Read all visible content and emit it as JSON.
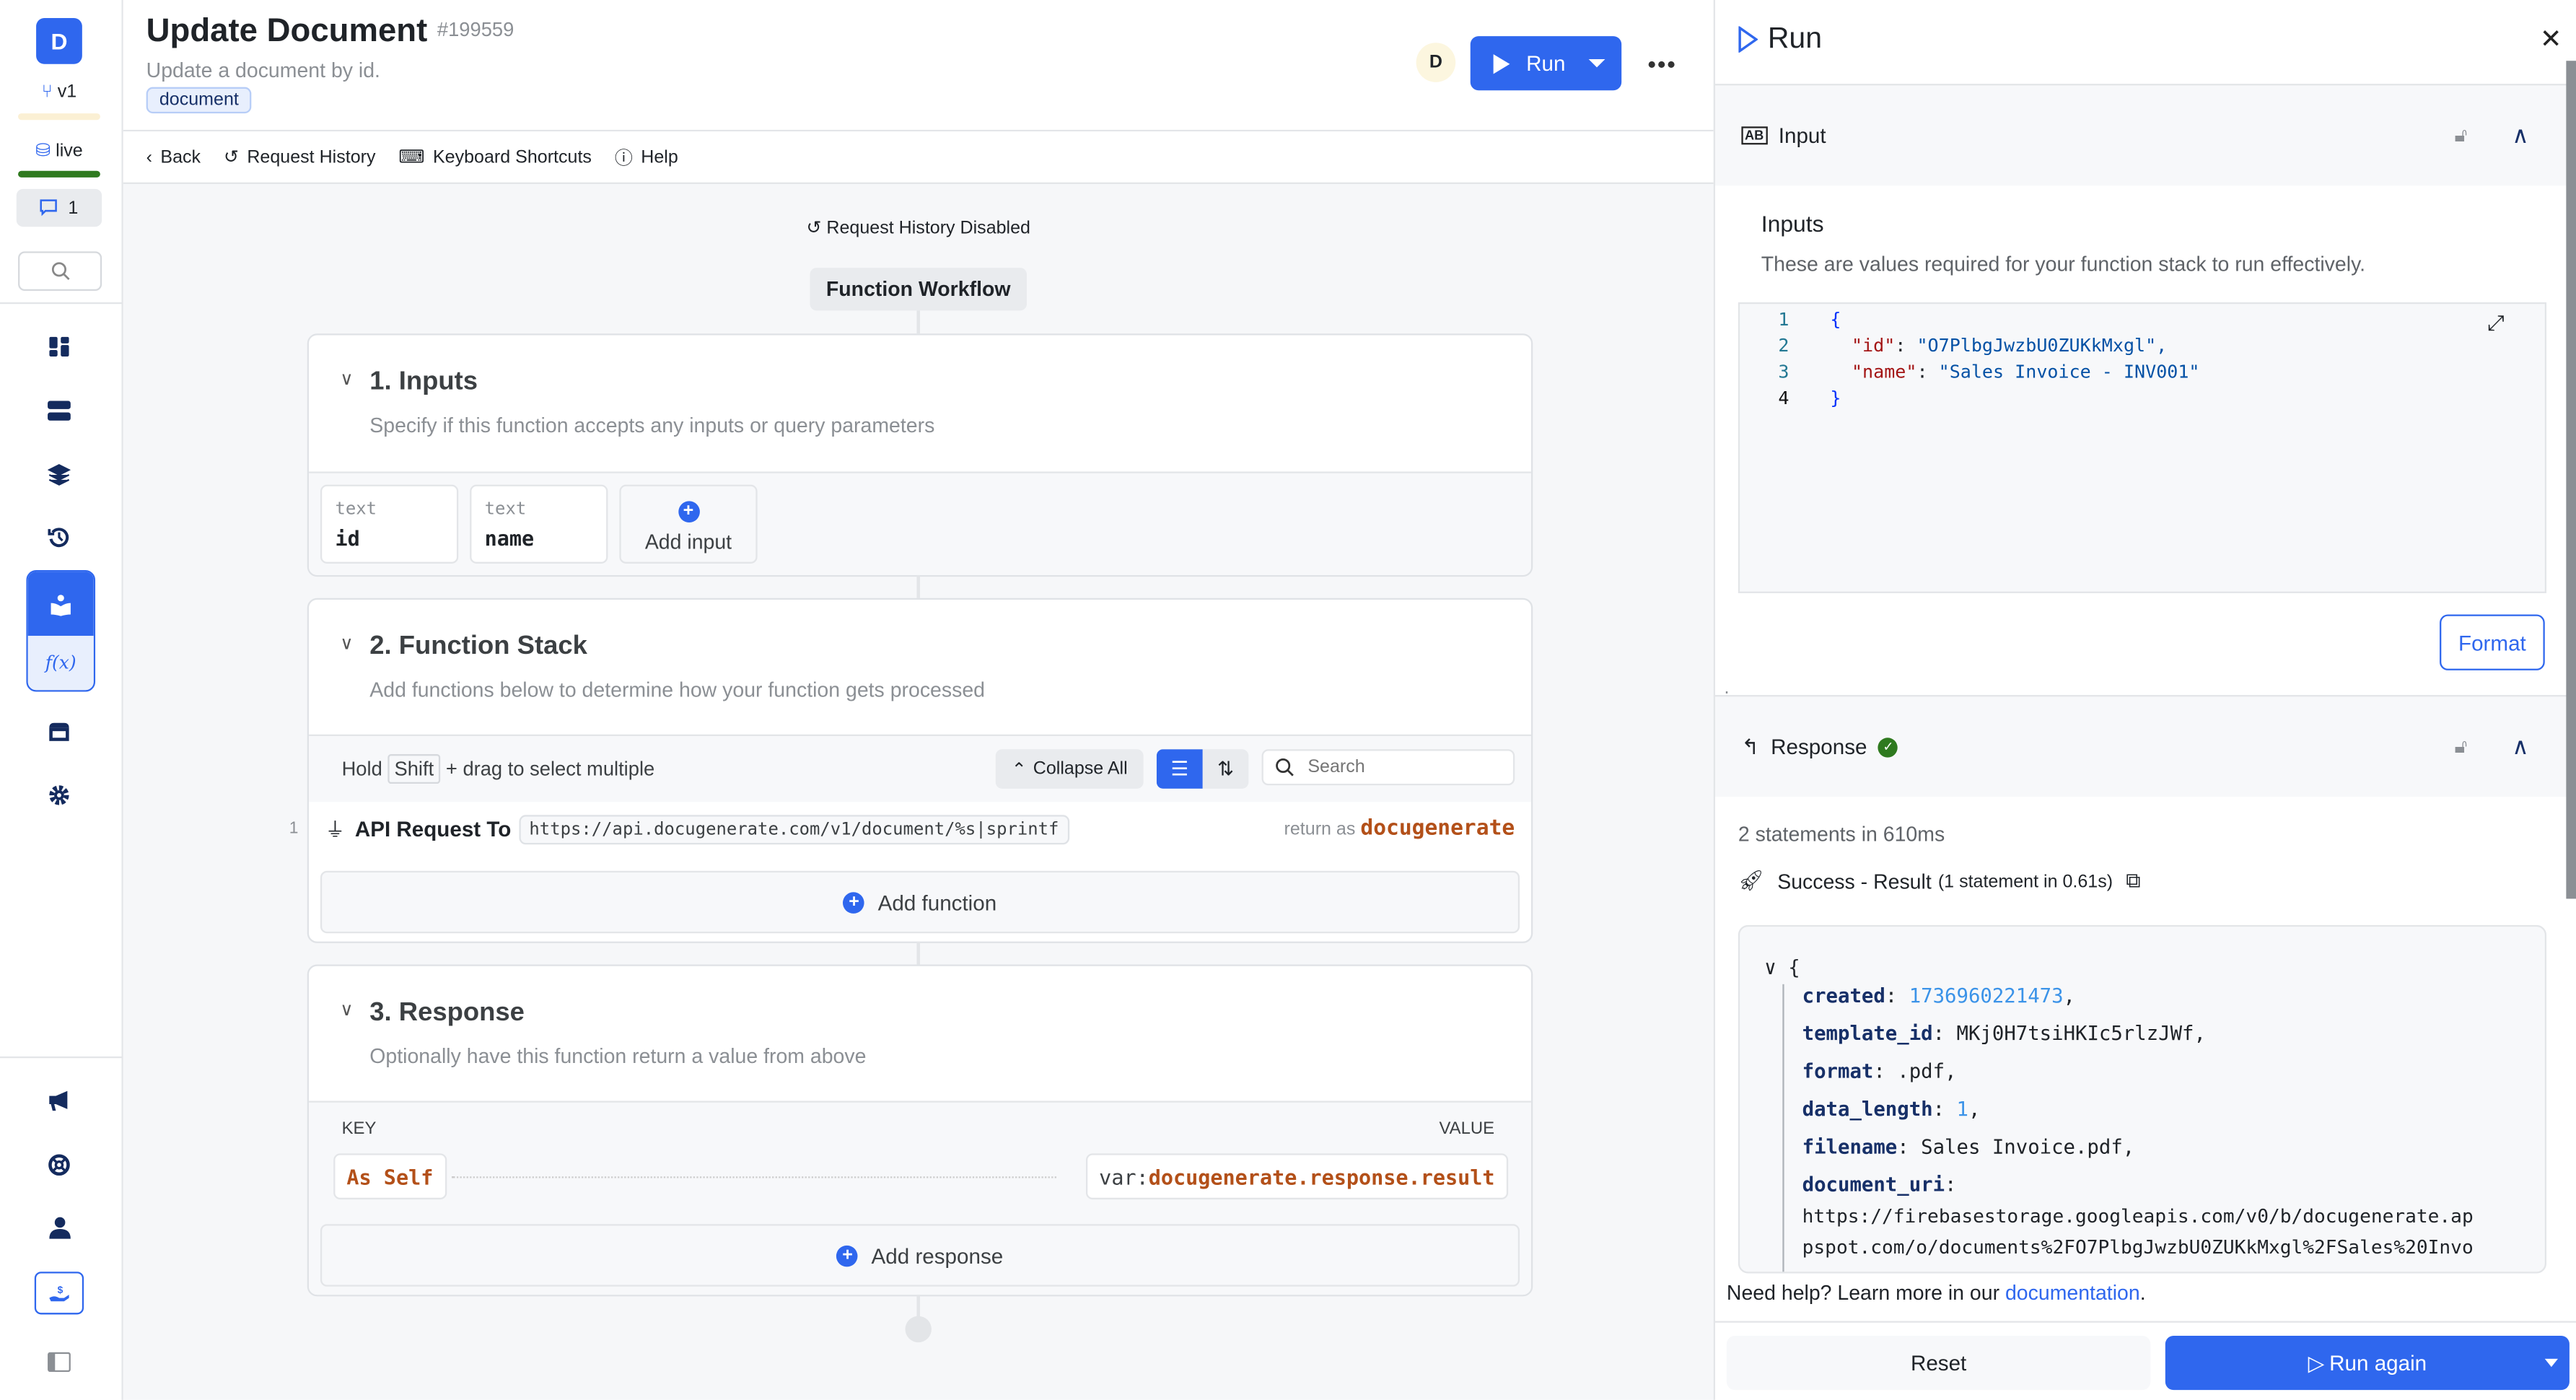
{
  "rail": {
    "logo_letter": "D",
    "branch": "v1",
    "environment": "live",
    "comment_count": "1",
    "icons": [
      "dashboard-icon",
      "database-icon",
      "layers-icon",
      "history-icon",
      "library-icon",
      "function-icon",
      "marketplace-icon",
      "settings-icon",
      "megaphone-icon",
      "support-icon",
      "user-icon",
      "billing-icon",
      "sidebar-toggle-icon"
    ]
  },
  "header": {
    "title": "Update Document",
    "id": "#199559",
    "description": "Update a document by id.",
    "tag": "document",
    "avatar_letter": "D",
    "run_label": "Run",
    "more_label": "•••"
  },
  "toolbar": {
    "back": "Back",
    "request_history": "Request History",
    "keyboard_shortcuts": "Keyboard Shortcuts",
    "help": "Help"
  },
  "canvas": {
    "request_history_status": "Request History Disabled",
    "workflow_label": "Function Workflow",
    "inputs": {
      "title": "1. Inputs",
      "description": "Specify if this function accepts any inputs or query parameters",
      "items": [
        {
          "type": "text",
          "name": "id"
        },
        {
          "type": "text",
          "name": "name"
        }
      ],
      "add_label": "Add input"
    },
    "function_stack": {
      "title": "2. Function Stack",
      "description": "Add functions below to determine how your function gets processed",
      "hint_pre": "Hold",
      "hint_key": "Shift",
      "hint_post": "+ drag to select multiple",
      "collapse_all": "Collapse All",
      "search_placeholder": "Search",
      "functions": [
        {
          "index": "1",
          "name": "API Request To",
          "url": "https://api.docugenerate.com/v1/document/%s|sprintf",
          "return_prefix": "return as",
          "return_var": "docugenerate"
        }
      ],
      "add_label": "Add function"
    },
    "response": {
      "title": "3. Response",
      "description": "Optionally have this function return a value from above",
      "key_header": "KEY",
      "value_header": "VALUE",
      "key": "As Self",
      "value_prefix": "var:",
      "value": "docugenerate.response.result",
      "add_label": "Add response"
    }
  },
  "run_panel": {
    "title": "Run",
    "input_section": "Input",
    "inputs_heading": "Inputs",
    "inputs_description": "These are values required for your function stack to run effectively.",
    "editor_lines": [
      {
        "n": "1",
        "text": "{"
      },
      {
        "n": "2",
        "key": "\"id\"",
        "value": "\"O7PlbgJwzbU0ZUKkMxgl\","
      },
      {
        "n": "3",
        "key": "\"name\"",
        "value": "\"Sales Invoice - INV001\""
      },
      {
        "n": "4",
        "text": "}"
      }
    ],
    "format_label": "Format",
    "response_section": "Response",
    "stats": "2 statements in 610ms",
    "result_label": "Success - Result",
    "result_detail": "(1 statement in 0.61s)",
    "result": {
      "open": "{",
      "fields": [
        {
          "key": "created",
          "value": "1736960221473",
          "numeric": true
        },
        {
          "key": "template_id",
          "value": "MKj0H7tsiHKIc5rlzJWf",
          "numeric": false
        },
        {
          "key": "format",
          "value": ".pdf",
          "numeric": false
        },
        {
          "key": "data_length",
          "value": "1",
          "numeric": true
        },
        {
          "key": "filename",
          "value": "Sales Invoice.pdf",
          "numeric": false
        }
      ],
      "uri_key": "document_uri",
      "uri_line1": "https://firebasestorage.googleapis.com/v0/b/docugenerate.ap",
      "uri_line2": "pspot.com/o/documents%2FO7PlbgJwzbU0ZUKkMxgl%2FSales%20Invo"
    },
    "help_text": "Need help? Learn more in our",
    "help_link": "documentation",
    "help_end": ".",
    "reset_label": "Reset",
    "run_again_label": "Run again"
  }
}
